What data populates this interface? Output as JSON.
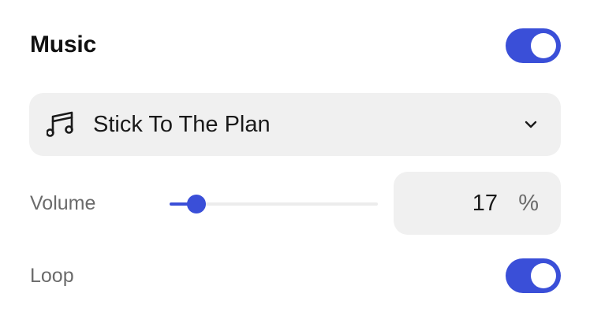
{
  "music": {
    "title": "Music",
    "enabled": true
  },
  "track": {
    "name": "Stick To The Plan",
    "icon": "music-note-icon",
    "dropdown_icon": "chevron-down-icon"
  },
  "volume": {
    "label": "Volume",
    "value": "17",
    "unit": "%",
    "level_fraction": 0.09
  },
  "loop": {
    "label": "Loop",
    "enabled": true
  },
  "colors": {
    "accent": "#3a4fd8",
    "field_background": "#f0f0f0",
    "muted_text": "#6b6b6b"
  }
}
